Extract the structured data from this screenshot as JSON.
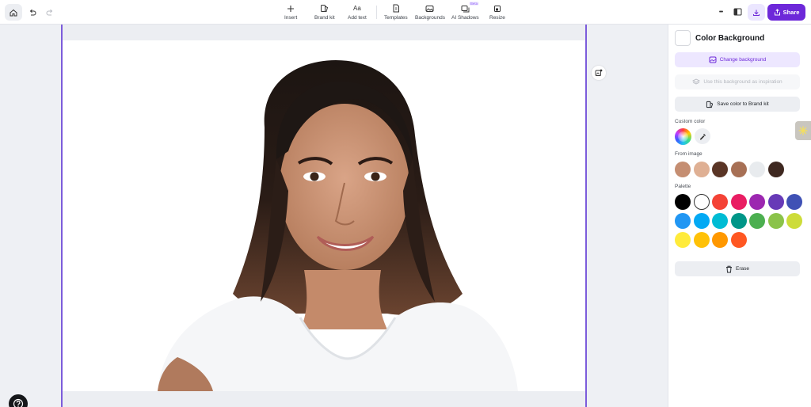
{
  "toolbar": {
    "insert_label": "Insert",
    "brand_kit_label": "Brand kit",
    "add_text_label": "Add text",
    "add_text_glyph": "Aa",
    "templates_label": "Templates",
    "backgrounds_label": "Backgrounds",
    "ai_shadows_label": "AI Shadows",
    "ai_shadows_badge": "Beta",
    "resize_label": "Resize",
    "share_label": "Share",
    "more_glyph": "•••"
  },
  "panel": {
    "title": "Color Background",
    "change_background": "Change background",
    "use_as_inspiration": "Use this background as inspiration",
    "save_color": "Save color to Brand kit",
    "custom_color_label": "Custom color",
    "from_image_label": "From image",
    "palette_label": "Palette",
    "erase_label": "Erase",
    "from_image_colors": [
      "#c58e72",
      "#dfb094",
      "#5a3526",
      "#a77055",
      "#e8ebee",
      "#3e2820"
    ],
    "palette_colors": [
      "#000000",
      "#ffffff",
      "#f44336",
      "#e91e63",
      "#9c27b0",
      "#673ab7",
      "#3f51b5",
      "#2196f3",
      "#03a9f4",
      "#00bcd4",
      "#009688",
      "#4caf50",
      "#8bc34a",
      "#cddc39",
      "#ffeb3b",
      "#ffc107",
      "#ff9800",
      "#ff5722"
    ]
  },
  "colors": {
    "accent": "#6d28d9",
    "artboard_border": "#7c5cdb"
  },
  "icons": {
    "home": "home-icon",
    "undo": "undo-icon",
    "redo": "redo-icon",
    "help": "help-icon",
    "eyedropper": "eyedropper-icon"
  }
}
